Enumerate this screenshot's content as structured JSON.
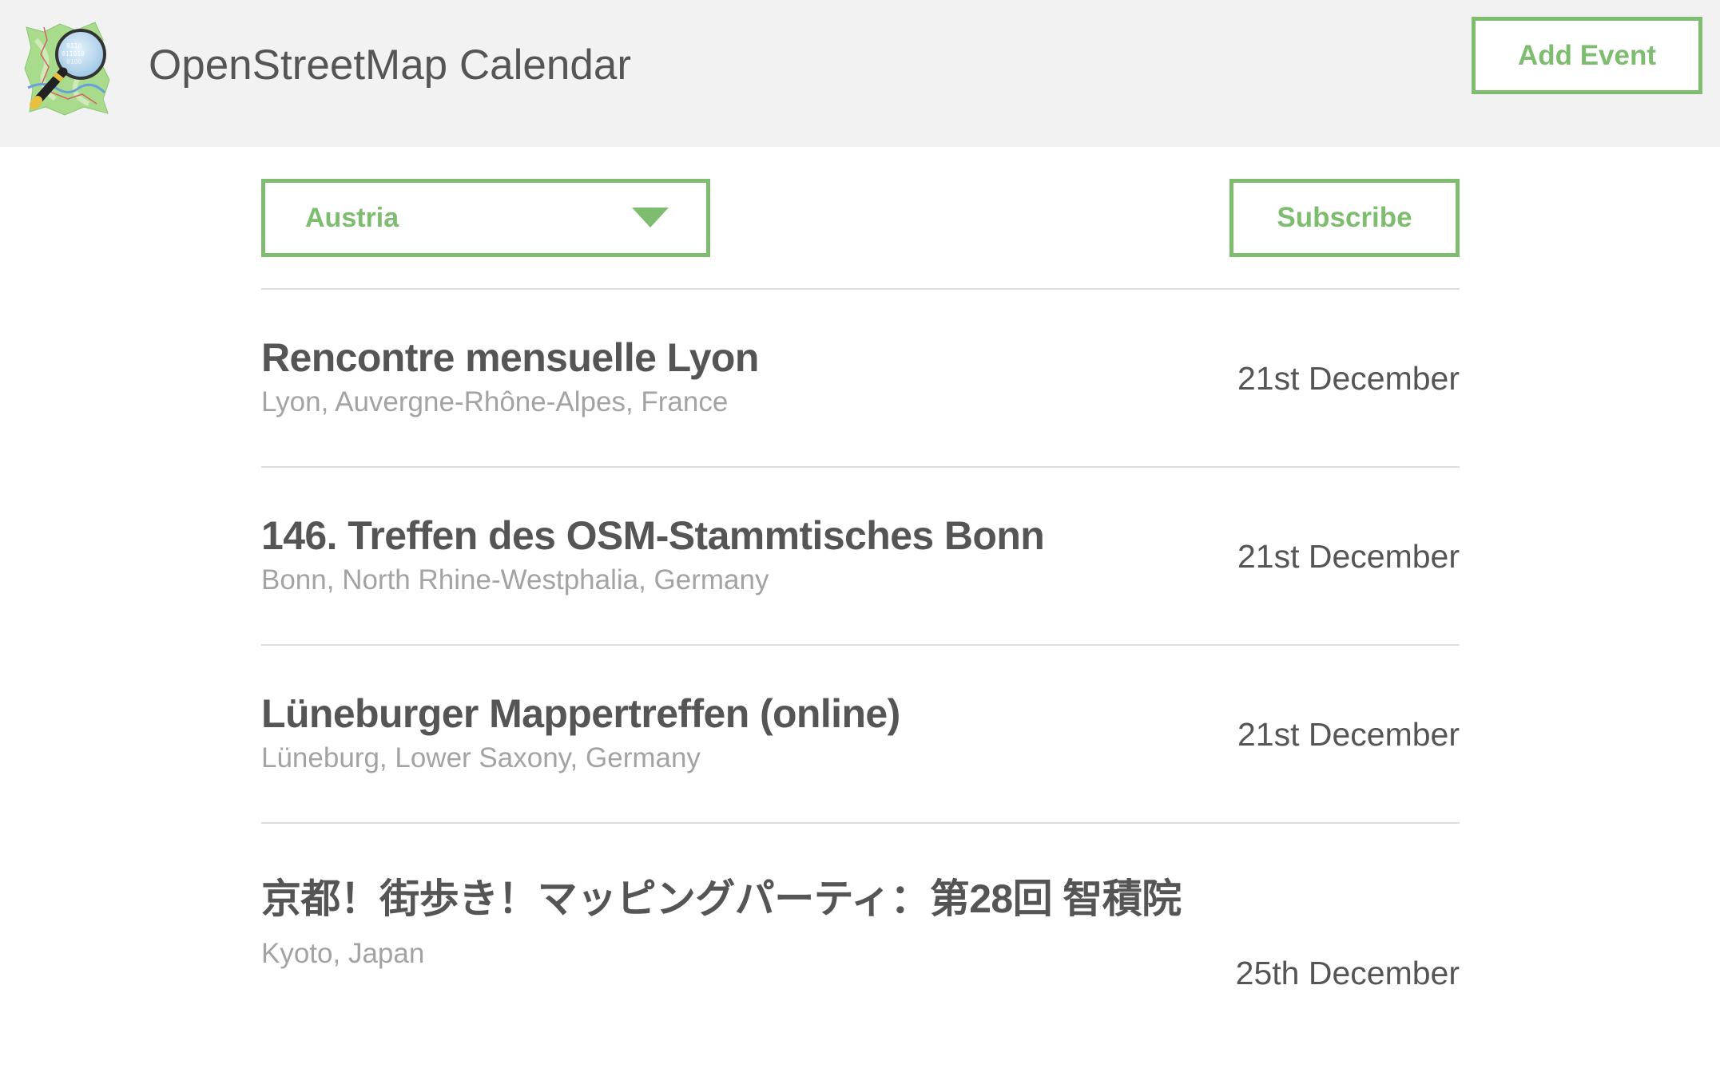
{
  "header": {
    "logo_icon": "openstreetmap-magnifier-logo-icon",
    "title": "OpenStreetMap Calendar",
    "add_event_label": "Add Event"
  },
  "filters": {
    "region_selected": "Austria",
    "region_dropdown_icon": "caret-down-icon",
    "subscribe_label": "Subscribe"
  },
  "events": [
    {
      "title": "Rencontre mensuelle Lyon",
      "location": "Lyon, Auvergne-Rhône-Alpes, France",
      "date": "21st December"
    },
    {
      "title": "146. Treffen des OSM-Stammtisches Bonn",
      "location": "Bonn, North Rhine-Westphalia, Germany",
      "date": "21st December"
    },
    {
      "title": "Lüneburger Mappertreffen (online)",
      "location": "Lüneburg, Lower Saxony, Germany",
      "date": "21st December"
    },
    {
      "title": "京都！街歩き！マッピングパーティ：第28回 智積院",
      "location": "Kyoto, Japan",
      "date": "25th December"
    }
  ],
  "colors": {
    "accent": "#7ebc6f",
    "header_background": "#f2f2f2",
    "text": "#555555",
    "muted_text": "#a3a3a3",
    "divider": "#dddddd"
  }
}
